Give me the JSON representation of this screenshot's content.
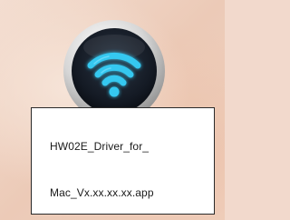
{
  "file": {
    "name_line_1": "HW02E_Driver_for_",
    "name_line_2": "Mac_Vx.xx.xx.xx.app"
  },
  "icon": {
    "name": "wifi-icon",
    "colors": {
      "glyph": "#35c8f0",
      "glyph_glow": "#8fe6ff",
      "disc": "#141a24",
      "rim_light": "#f2f2f2",
      "rim_dark": "#8c8c8c"
    }
  },
  "colors": {
    "desktop": "#f2d9cc",
    "label_background": "#ffffff",
    "label_border": "#2a2a2a",
    "label_text": "#1a1a1a"
  }
}
